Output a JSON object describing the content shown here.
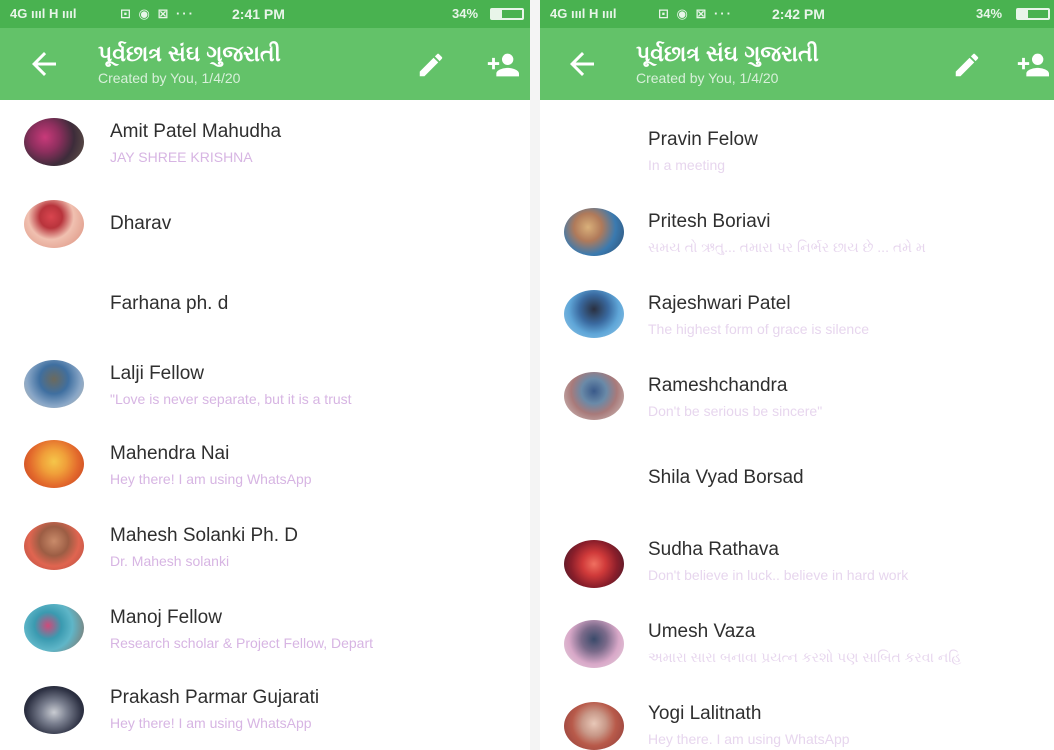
{
  "left": {
    "status_bar": {
      "network": "4G ıııl H ıııl",
      "icons": "⊡ ◉ ⊠ ···",
      "time": "2:41 PM",
      "battery": "34%"
    },
    "header": {
      "title": "પૂર્વછાત્ર સંઘ ગુજરાતી",
      "subtitle": "Created by You, 1/4/20"
    },
    "members": [
      {
        "name": "Amit Patel Mahudha",
        "status": "JAY SHREE KRISHNA"
      },
      {
        "name": "Dharav",
        "status": ""
      },
      {
        "name": "Farhana ph. d",
        "status": ""
      },
      {
        "name": "Lalji Fellow",
        "status": "\"Love is never separate, but it is a trust"
      },
      {
        "name": "Mahendra Nai",
        "status": "Hey there! I am using WhatsApp"
      },
      {
        "name": "Mahesh Solanki Ph. D",
        "status": "Dr. Mahesh solanki"
      },
      {
        "name": "Manoj Fellow",
        "status": "Research scholar & Project Fellow, Depart"
      },
      {
        "name": "Prakash Parmar Gujarati",
        "status": "Hey there! I am using WhatsApp"
      }
    ]
  },
  "right": {
    "status_bar": {
      "network": "4G ıııl H ıııl",
      "icons": "⊡ ◉ ⊠ ···",
      "time": "2:42 PM",
      "battery": "34%"
    },
    "header": {
      "title": "પૂર્વછાત્ર સંઘ ગુજરાતી",
      "subtitle": "Created by You, 1/4/20"
    },
    "members": [
      {
        "name": "Pravin Felow",
        "status": "In a meeting"
      },
      {
        "name": "Pritesh Boriavi",
        "status": "સમય તો ઋતુ... તમારા પર નિર્ભર છાય છે ... તમે મ"
      },
      {
        "name": "Rajeshwari Patel",
        "status": "The highest form of grace is silence"
      },
      {
        "name": "Rameshchandra",
        "status": " Don't be serious be sincere\""
      },
      {
        "name": "Shila Vyad Borsad",
        "status": ""
      },
      {
        "name": "Sudha Rathava",
        "status": "Don't believe in luck.. believe in hard work"
      },
      {
        "name": "Umesh Vaza",
        "status": "અમારા સારા બનાવા પ્રયત્ન કરશો પણ સાબિત કરવા નહિ"
      },
      {
        "name": "Yogi Lalitnath",
        "status": "Hey there. I am using WhatsApp"
      }
    ]
  },
  "colors": {
    "statusbar": "#49b250",
    "appbar": "#63c269",
    "name": "#2f2f2f",
    "status": "#d7b5e3"
  }
}
